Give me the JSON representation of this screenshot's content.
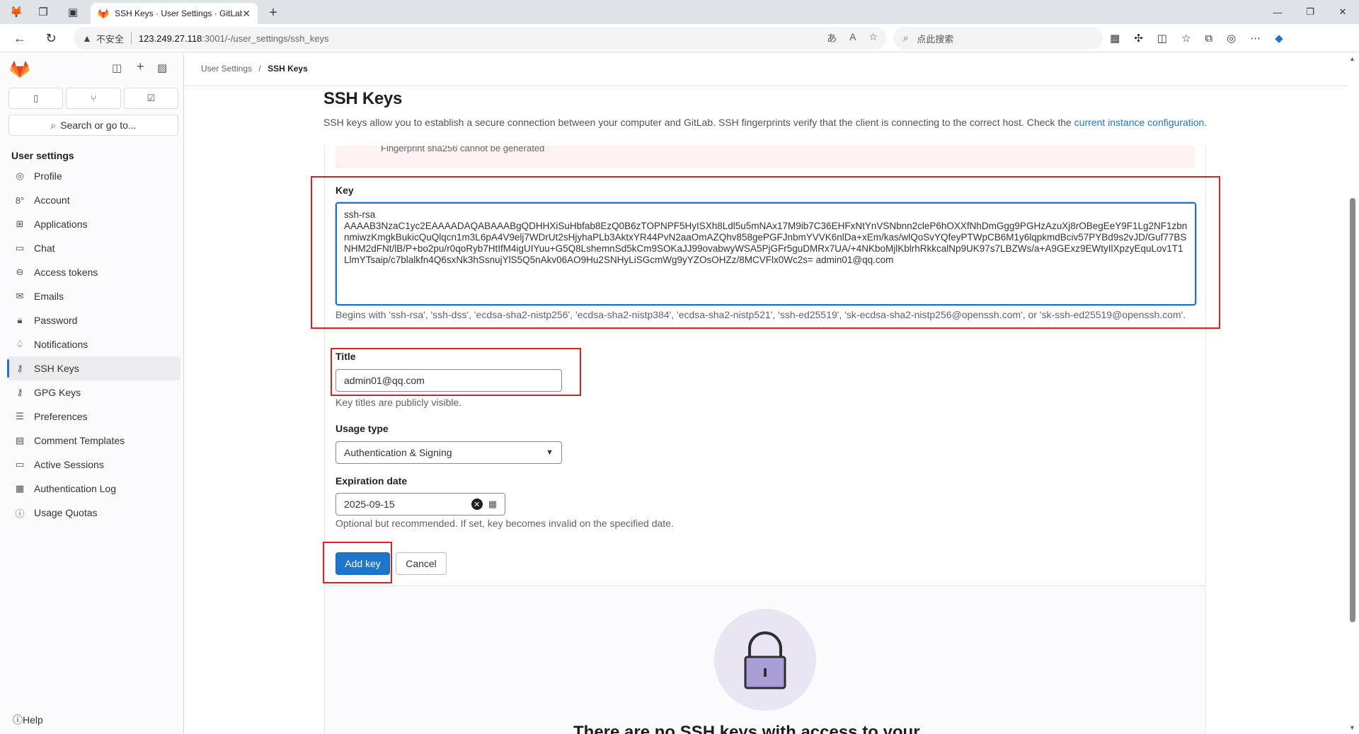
{
  "browser": {
    "tab_title": "SSH Keys · User Settings · GitLab",
    "address_insecure": "不安全",
    "address_host": "123.249.27.118",
    "address_path": ":3001/-/user_settings/ssh_keys",
    "search_placeholder": "点此搜索"
  },
  "sidebar": {
    "search_label": "Search or go to...",
    "heading": "User settings",
    "items": [
      {
        "label": "Profile",
        "icon": "user-circle-icon"
      },
      {
        "label": "Account",
        "icon": "account-icon"
      },
      {
        "label": "Applications",
        "icon": "applications-icon"
      },
      {
        "label": "Chat",
        "icon": "chat-icon"
      },
      {
        "label": "Access tokens",
        "icon": "token-icon"
      },
      {
        "label": "Emails",
        "icon": "mail-icon"
      },
      {
        "label": "Password",
        "icon": "lock-icon"
      },
      {
        "label": "Notifications",
        "icon": "bell-icon"
      },
      {
        "label": "SSH Keys",
        "icon": "key-icon"
      },
      {
        "label": "GPG Keys",
        "icon": "key-icon"
      },
      {
        "label": "Preferences",
        "icon": "sliders-icon"
      },
      {
        "label": "Comment Templates",
        "icon": "comment-icon"
      },
      {
        "label": "Active Sessions",
        "icon": "monitor-icon"
      },
      {
        "label": "Authentication Log",
        "icon": "log-icon"
      },
      {
        "label": "Usage Quotas",
        "icon": "quota-icon"
      }
    ],
    "help_label": "Help"
  },
  "breadcrumb": {
    "parent": "User Settings",
    "separator": "/",
    "current": "SSH Keys"
  },
  "page": {
    "title": "SSH Keys",
    "description": "SSH keys allow you to establish a secure connection between your computer and GitLab. SSH fingerprints verify that the client is connecting to the correct host. Check the ",
    "description_link": "current instance configuration",
    "description_end": ".",
    "alert_fragment": "Fingerprint sha256 cannot be generated"
  },
  "form": {
    "key_label": "Key",
    "key_value": "ssh-rsa\nAAAAB3NzaC1yc2EAAAADAQABAAABgQDHHXiSuHbfab8EzQ0B6zTOPNPF5HyISXh8Ldl5u5mNAx17M9ib7C36EHFxNtYnVSNbnn2cleP6hOXXfNhDmGgg9PGHzAzuXj8rOBegEeY9F1Lg2NF1zbnnmiwzKmgkBukicQuQlqcn1m3L6pA4V9elj7WDrUt2sHjyhaPLb3AktxYR44PvN2aaOmAZQhv858gePGFJnbmYVVK6nlDa+xEm/kas/wlQoSvYQfeyPTWpCB6M1y6lqpkmdBciv57PYBd9s2vJD/Guf77BSNHM2dFNt/lB/P+bo2pu/r0qoRyb7HtIfM4igUIYuu+G5Q8LshemnSd5kCm9SOKaJJ99ovabwyWSA5PjGFr5guDMRx7UA/+4NKboMjlKblrhRkkcalNp9UK97s7LBZWs/a+A9GExz9EWtyIlXpzyEquLov1T1LlmYTsaip/c7blalkfn4Q6sxNk3hSsnujYlS5Q5nAkv06AO9Hu2SNHyLiSGcmWg9yYZOsOHZz/8MCVFlx0Wc2s= admin01@qq.com",
    "key_help": "Begins with 'ssh-rsa', 'ssh-dss', 'ecdsa-sha2-nistp256', 'ecdsa-sha2-nistp384', 'ecdsa-sha2-nistp521', 'ssh-ed25519', 'sk-ecdsa-sha2-nistp256@openssh.com', or 'sk-ssh-ed25519@openssh.com'.",
    "title_label": "Title",
    "title_value": "admin01@qq.com",
    "title_help": "Key titles are publicly visible.",
    "usage_label": "Usage type",
    "usage_value": "Authentication & Signing",
    "expiration_label": "Expiration date",
    "expiration_value": "2025-09-15",
    "expiration_help": "Optional but recommended. If set, key becomes invalid on the specified date.",
    "add_button": "Add key",
    "cancel_button": "Cancel"
  },
  "empty_state": {
    "text": "There are no SSH keys with access to your"
  },
  "colors": {
    "primary": "#1f75cb",
    "highlight_box": "#e02020",
    "sidebar_bg": "#fbfafd"
  }
}
